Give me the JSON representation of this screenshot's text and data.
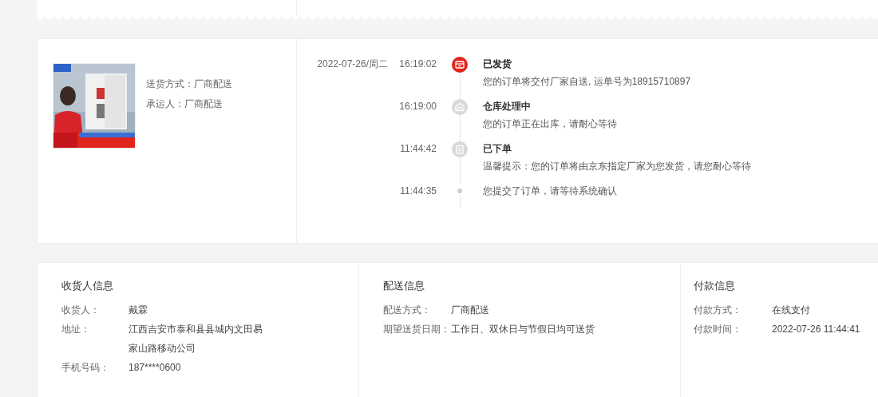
{
  "shipment": {
    "fields": [
      {
        "label": "送货方式：",
        "value": "厂商配送"
      },
      {
        "label": "承运人：",
        "value": "厂商配送"
      }
    ]
  },
  "timeline": {
    "date": "2022-07-26/周二",
    "events": [
      {
        "time": "16:19:02",
        "kind": "shipped",
        "active": true,
        "title": "已发货",
        "text": "您的订单将交付厂家自送, 运单号为18915710897"
      },
      {
        "time": "16:19:00",
        "kind": "warehouse",
        "active": false,
        "title": "仓库处理中",
        "text": "您的订单正在出库，请耐心等待"
      },
      {
        "time": "11:44:42",
        "kind": "ordered",
        "active": false,
        "title": "已下单",
        "text": "温馨提示：您的订单将由京东指定厂家为您发货，请您耐心等待"
      },
      {
        "time": "11:44:35",
        "kind": "submitted",
        "active": false,
        "text": "您提交了订单，请等待系统确认"
      }
    ]
  },
  "info": [
    {
      "title": "收货人信息",
      "rows": [
        {
          "label": "收货人：",
          "value": "戴霖"
        },
        {
          "label": "地址：",
          "value": "江西吉安市泰和县县城内文田易家山路移动公司"
        },
        {
          "label": "手机号码：",
          "value": "187****0600"
        }
      ]
    },
    {
      "title": "配送信息",
      "rows": [
        {
          "label": "配送方式：",
          "value": "厂商配送"
        },
        {
          "label": "期望送货日期：",
          "value": "工作日、双休日与节假日均可送货"
        }
      ]
    },
    {
      "title": "付款信息",
      "rows": [
        {
          "label": "付款方式：",
          "value": "在线支付"
        },
        {
          "label": "付款时间：",
          "value": "2022-07-26 11:44:41"
        }
      ]
    }
  ]
}
